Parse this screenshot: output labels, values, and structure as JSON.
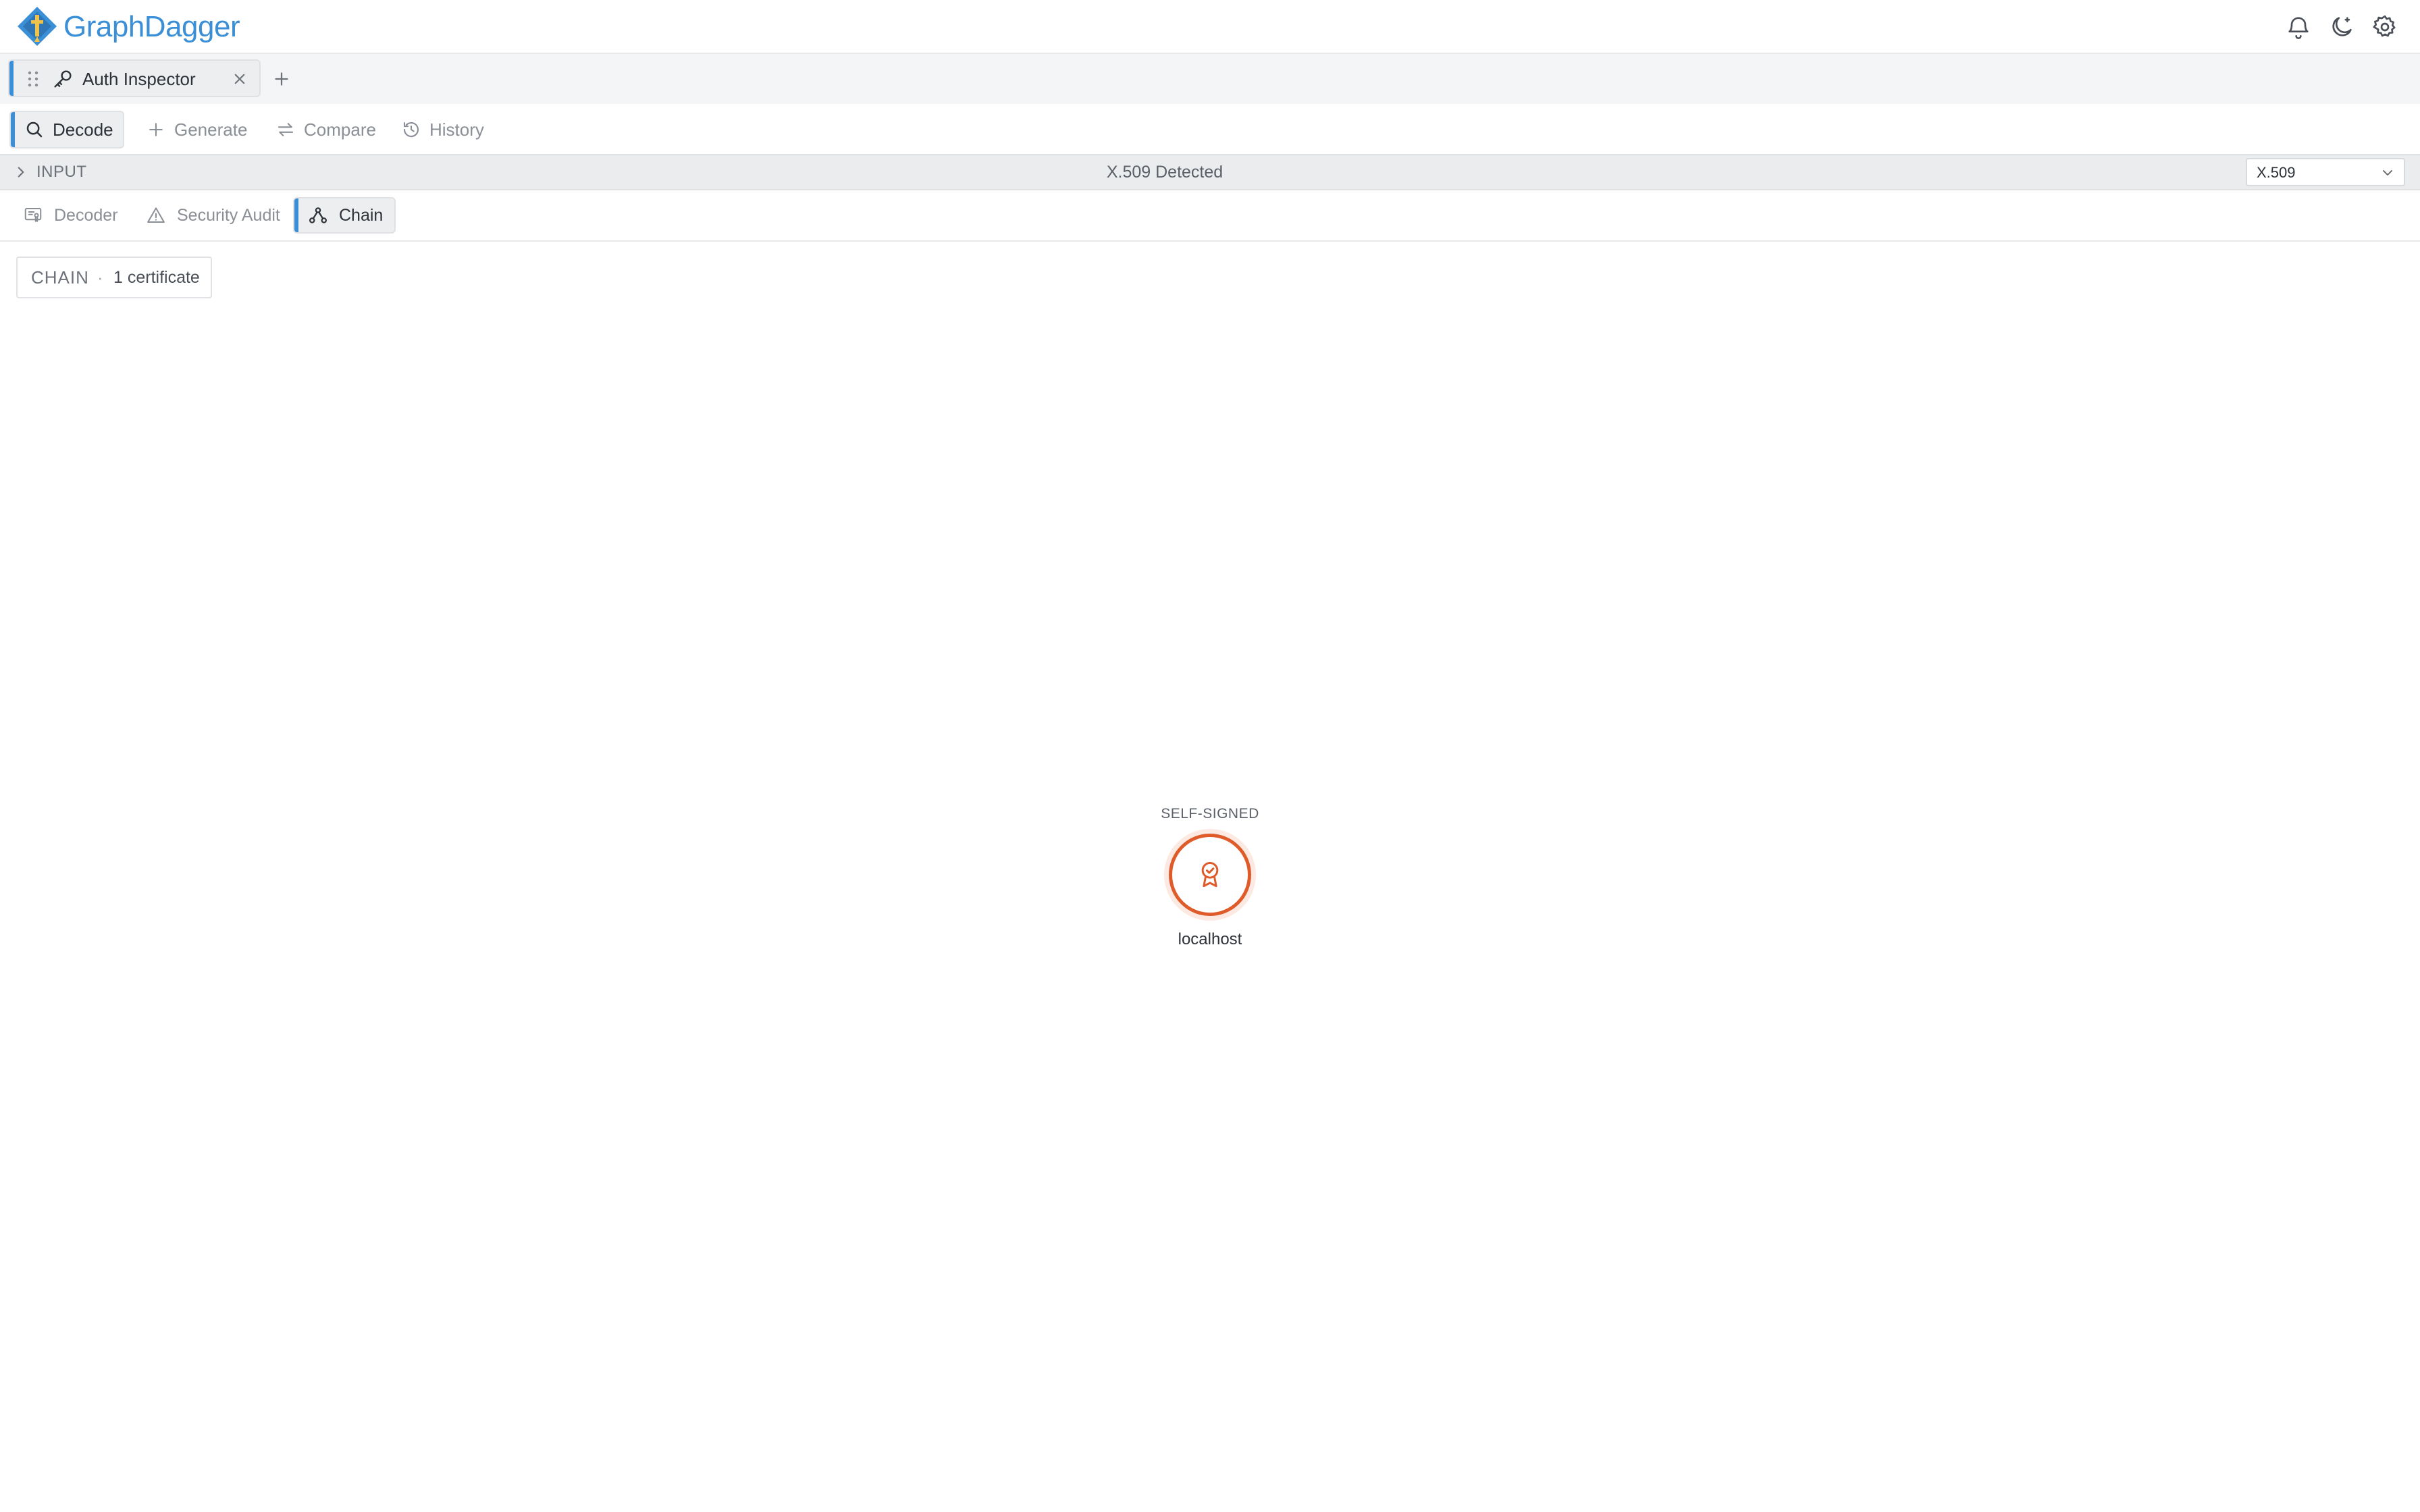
{
  "app": {
    "name": "GraphDagger"
  },
  "header": {
    "icons": [
      "bell-icon",
      "moon-icon",
      "gear-icon"
    ]
  },
  "tabs": {
    "active": {
      "label": "Auth Inspector"
    }
  },
  "toolbar": {
    "decode": "Decode",
    "generate": "Generate",
    "compare": "Compare",
    "history": "History"
  },
  "input": {
    "label": "INPUT",
    "detected": "X.509 Detected",
    "format": "X.509"
  },
  "subtabs": {
    "decoder": "Decoder",
    "audit": "Security Audit",
    "chain": "Chain"
  },
  "chain": {
    "title": "CHAIN",
    "separator": "·",
    "count": "1 certificate",
    "nodes": [
      {
        "tag": "SELF-SIGNED",
        "name": "localhost",
        "status_color": "#df5b2a"
      }
    ]
  },
  "colors": {
    "accent": "#3a8fd6",
    "warning": "#df5b2a"
  }
}
